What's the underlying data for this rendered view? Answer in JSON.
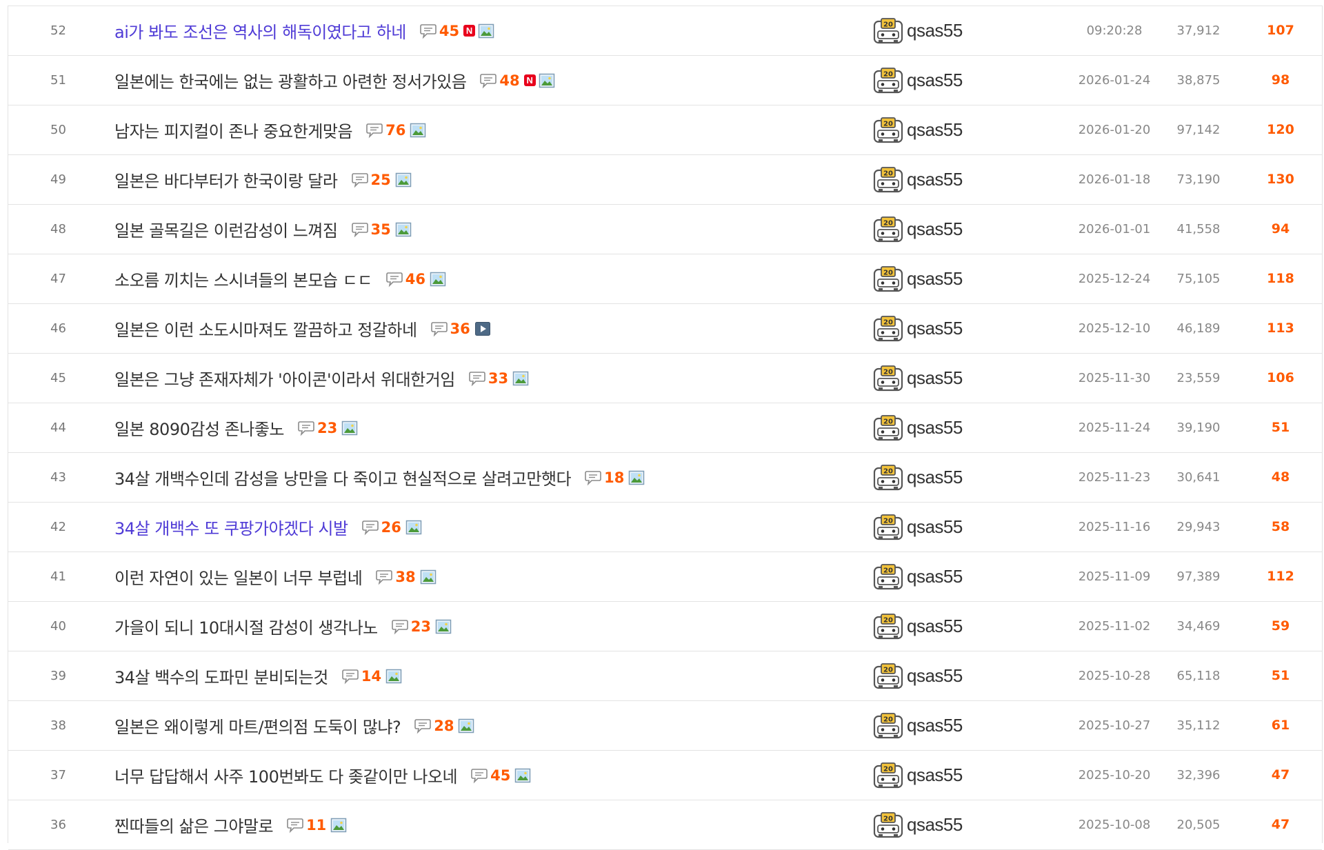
{
  "colors": {
    "accent": "#ff5a00",
    "visited_title": "#4f3bd6",
    "normal_title": "#333333",
    "meta_text": "#888888",
    "new_badge": "#e8001c"
  },
  "icons": {
    "reply": "speech-bubble-icon",
    "image": "image-icon",
    "video": "video-icon",
    "new": "new-badge-icon",
    "level": "level-20-icon"
  },
  "new_badge_label": "N",
  "level_badge_label": "20",
  "posts": [
    {
      "num": "52",
      "title": "ai가 봐도 조선은 역사의 해독이였다고 하네",
      "visited": true,
      "replies": "45",
      "is_new": true,
      "media": "image",
      "writer": "qsas55",
      "date": "09:20:28",
      "views": "37,912",
      "recommend": "107"
    },
    {
      "num": "51",
      "title": "일본에는 한국에는 없는 광활하고 아련한 정서가있음",
      "visited": false,
      "replies": "48",
      "is_new": true,
      "media": "image",
      "writer": "qsas55",
      "date": "2026-01-24",
      "views": "38,875",
      "recommend": "98"
    },
    {
      "num": "50",
      "title": "남자는 피지컬이 존나 중요한게맞음",
      "visited": false,
      "replies": "76",
      "is_new": false,
      "media": "image",
      "writer": "qsas55",
      "date": "2026-01-20",
      "views": "97,142",
      "recommend": "120"
    },
    {
      "num": "49",
      "title": "일본은 바다부터가 한국이랑 달라",
      "visited": false,
      "replies": "25",
      "is_new": false,
      "media": "image",
      "writer": "qsas55",
      "date": "2026-01-18",
      "views": "73,190",
      "recommend": "130"
    },
    {
      "num": "48",
      "title": "일본 골목길은 이런감성이 느껴짐",
      "visited": false,
      "replies": "35",
      "is_new": false,
      "media": "image",
      "writer": "qsas55",
      "date": "2026-01-01",
      "views": "41,558",
      "recommend": "94"
    },
    {
      "num": "47",
      "title": "소오름 끼치는 스시녀들의 본모습 ㄷㄷ",
      "visited": false,
      "replies": "46",
      "is_new": false,
      "media": "image",
      "writer": "qsas55",
      "date": "2025-12-24",
      "views": "75,105",
      "recommend": "118"
    },
    {
      "num": "46",
      "title": "일본은 이런 소도시마져도 깔끔하고 정갈하네",
      "visited": false,
      "replies": "36",
      "is_new": false,
      "media": "video",
      "writer": "qsas55",
      "date": "2025-12-10",
      "views": "46,189",
      "recommend": "113"
    },
    {
      "num": "45",
      "title": "일본은 그냥 존재자체가 '아이콘'이라서 위대한거임",
      "visited": false,
      "replies": "33",
      "is_new": false,
      "media": "image",
      "writer": "qsas55",
      "date": "2025-11-30",
      "views": "23,559",
      "recommend": "106"
    },
    {
      "num": "44",
      "title": "일본 8090감성 존나좋노",
      "visited": false,
      "replies": "23",
      "is_new": false,
      "media": "image",
      "writer": "qsas55",
      "date": "2025-11-24",
      "views": "39,190",
      "recommend": "51"
    },
    {
      "num": "43",
      "title": "34살 개백수인데 감성을 낭만을 다 죽이고 현실적으로 살려고만햇다",
      "visited": false,
      "replies": "18",
      "is_new": false,
      "media": "image",
      "writer": "qsas55",
      "date": "2025-11-23",
      "views": "30,641",
      "recommend": "48"
    },
    {
      "num": "42",
      "title": "34살 개백수 또 쿠팡가야겠다 시발",
      "visited": true,
      "replies": "26",
      "is_new": false,
      "media": "image",
      "writer": "qsas55",
      "date": "2025-11-16",
      "views": "29,943",
      "recommend": "58"
    },
    {
      "num": "41",
      "title": "이런 자연이 있는 일본이 너무 부럽네",
      "visited": false,
      "replies": "38",
      "is_new": false,
      "media": "image",
      "writer": "qsas55",
      "date": "2025-11-09",
      "views": "97,389",
      "recommend": "112"
    },
    {
      "num": "40",
      "title": "가을이 되니 10대시절 감성이 생각나노",
      "visited": false,
      "replies": "23",
      "is_new": false,
      "media": "image",
      "writer": "qsas55",
      "date": "2025-11-02",
      "views": "34,469",
      "recommend": "59"
    },
    {
      "num": "39",
      "title": "34살 백수의 도파민 분비되는것",
      "visited": false,
      "replies": "14",
      "is_new": false,
      "media": "image",
      "writer": "qsas55",
      "date": "2025-10-28",
      "views": "65,118",
      "recommend": "51"
    },
    {
      "num": "38",
      "title": "일본은 왜이렇게 마트/편의점 도둑이 많냐?",
      "visited": false,
      "replies": "28",
      "is_new": false,
      "media": "image",
      "writer": "qsas55",
      "date": "2025-10-27",
      "views": "35,112",
      "recommend": "61"
    },
    {
      "num": "37",
      "title": "너무 답답해서 사주 100번봐도 다 좆같이만 나오네",
      "visited": false,
      "replies": "45",
      "is_new": false,
      "media": "image",
      "writer": "qsas55",
      "date": "2025-10-20",
      "views": "32,396",
      "recommend": "47"
    },
    {
      "num": "36",
      "title": "찐따들의 삶은 그야말로",
      "visited": false,
      "replies": "11",
      "is_new": false,
      "media": "image",
      "writer": "qsas55",
      "date": "2025-10-08",
      "views": "20,505",
      "recommend": "47"
    }
  ]
}
